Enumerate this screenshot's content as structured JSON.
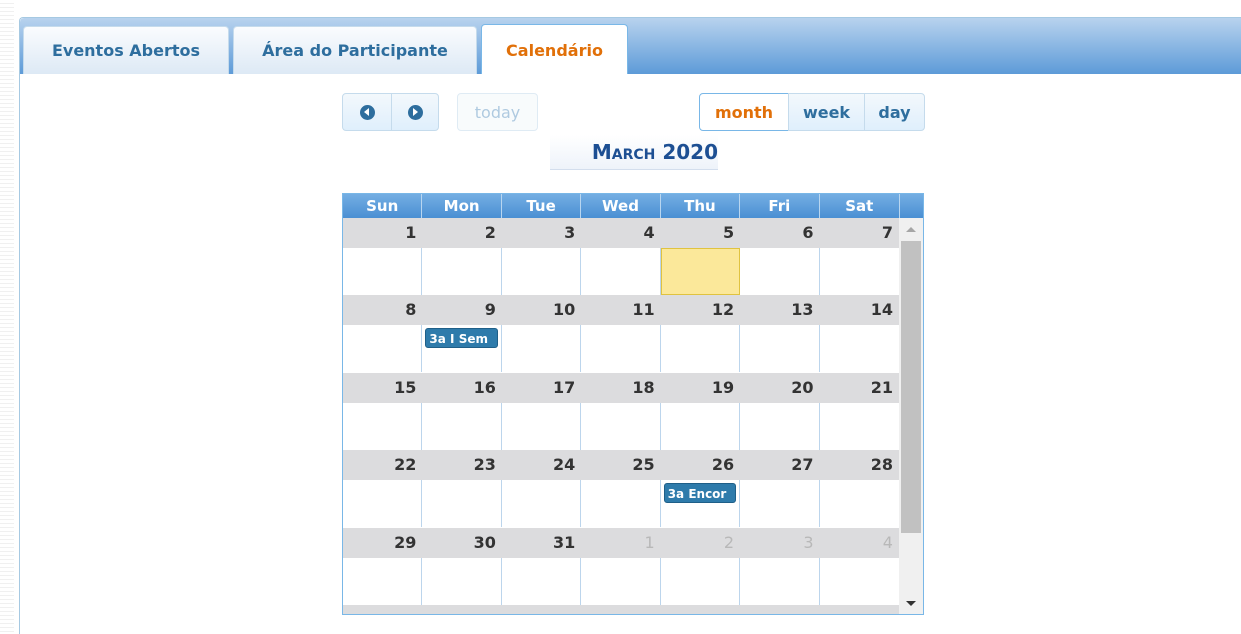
{
  "tabs": [
    {
      "label": "Eventos Abertos"
    },
    {
      "label": "Área do Participante"
    },
    {
      "label": "Calendário"
    }
  ],
  "toolbar": {
    "prev_icon": "circle-triangle-left-icon",
    "next_icon": "circle-triangle-right-icon",
    "today_label": "today",
    "views": [
      "month",
      "week",
      "day"
    ],
    "active_view": "month"
  },
  "calendar": {
    "title": "March 2020",
    "day_headers": [
      "Sun",
      "Mon",
      "Tue",
      "Wed",
      "Thu",
      "Fri",
      "Sat"
    ],
    "weeks": [
      [
        {
          "d": "1"
        },
        {
          "d": "2"
        },
        {
          "d": "3"
        },
        {
          "d": "4"
        },
        {
          "d": "5",
          "today": true
        },
        {
          "d": "6"
        },
        {
          "d": "7"
        }
      ],
      [
        {
          "d": "8"
        },
        {
          "d": "9"
        },
        {
          "d": "10"
        },
        {
          "d": "11"
        },
        {
          "d": "12"
        },
        {
          "d": "13"
        },
        {
          "d": "14"
        }
      ],
      [
        {
          "d": "15"
        },
        {
          "d": "16"
        },
        {
          "d": "17"
        },
        {
          "d": "18"
        },
        {
          "d": "19"
        },
        {
          "d": "20"
        },
        {
          "d": "21"
        }
      ],
      [
        {
          "d": "22"
        },
        {
          "d": "23"
        },
        {
          "d": "24"
        },
        {
          "d": "25"
        },
        {
          "d": "26"
        },
        {
          "d": "27"
        },
        {
          "d": "28"
        }
      ],
      [
        {
          "d": "29"
        },
        {
          "d": "30"
        },
        {
          "d": "31"
        },
        {
          "d": "1",
          "other": true
        },
        {
          "d": "2",
          "other": true
        },
        {
          "d": "3",
          "other": true
        },
        {
          "d": "4",
          "other": true
        }
      ]
    ],
    "events": [
      {
        "label": "3a I Sem",
        "week": 1,
        "day": 1
      },
      {
        "label": "3a Encor",
        "week": 3,
        "day": 4
      }
    ],
    "colors": {
      "event": "#2e7bab",
      "today": "#fbe89a",
      "title": "#1d4f93",
      "active_tab": "#e17009"
    }
  }
}
